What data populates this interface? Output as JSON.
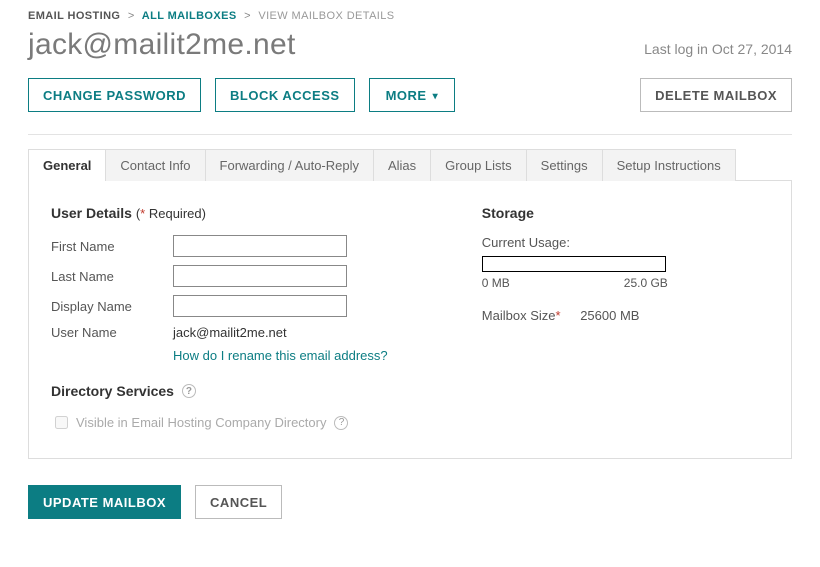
{
  "breadcrumb": {
    "root": "EMAIL HOSTING",
    "link": "ALL MAILBOXES",
    "current": "VIEW MAILBOX DETAILS"
  },
  "title": "jack@mailit2me.net",
  "last_login_label": "Last log in Oct 27, 2014",
  "actions": {
    "change_password": "Change Password",
    "block_access": "Block Access",
    "more": "More",
    "delete_mailbox": "Delete Mailbox"
  },
  "tabs": [
    "General",
    "Contact Info",
    "Forwarding / Auto-Reply",
    "Alias",
    "Group Lists",
    "Settings",
    "Setup Instructions"
  ],
  "user_details": {
    "heading": "User Details",
    "required_note_prefix": "(",
    "required_asterisk": "*",
    "required_note_suffix": " Required)",
    "fields": {
      "first_name_label": "First Name",
      "first_name_value": "",
      "last_name_label": "Last Name",
      "last_name_value": "",
      "display_name_label": "Display Name",
      "display_name_value": "",
      "user_name_label": "User Name",
      "user_name_value": "jack@mailit2me.net"
    },
    "rename_link": "How do I rename this email address?"
  },
  "storage": {
    "heading": "Storage",
    "current_usage_label": "Current Usage:",
    "min_scale": "0 MB",
    "max_scale": "25.0 GB",
    "mailbox_size_label": "Mailbox Size",
    "mailbox_size_value": "25600 MB"
  },
  "directory": {
    "heading": "Directory Services",
    "visible_label": "Visible in Email Hosting Company Directory"
  },
  "footer": {
    "update": "Update Mailbox",
    "cancel": "Cancel"
  }
}
